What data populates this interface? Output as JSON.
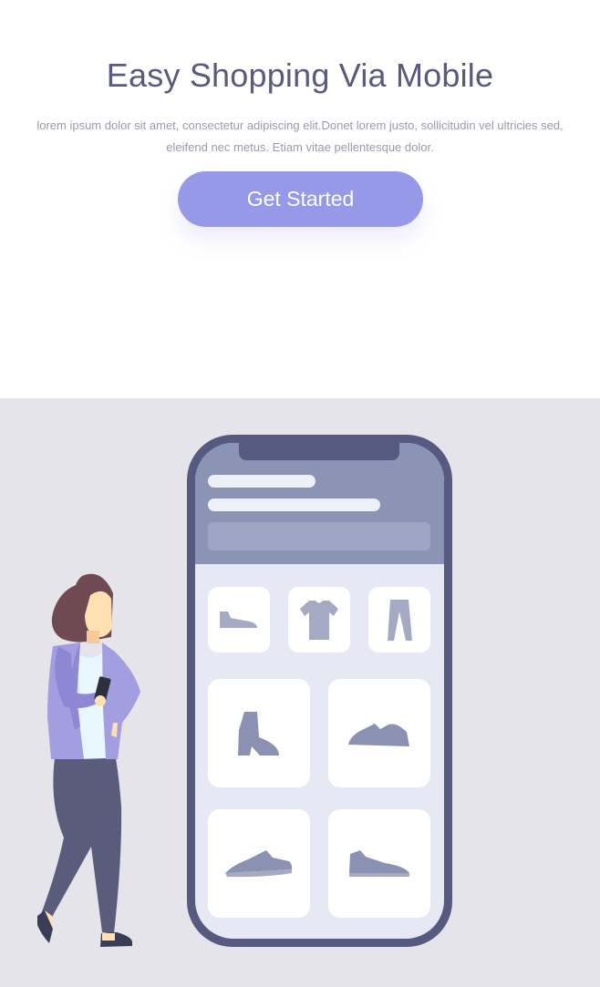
{
  "hero": {
    "title": "Easy Shopping Via Mobile",
    "description": "lorem ipsum dolor sit amet, consectetur adipiscing elit.Donet lorem justo, sollicitudin vel ultricies sed, eleifend nec metus. Etiam vitae pellentesque dolor.",
    "cta_label": "Get Started"
  },
  "colors": {
    "accent": "#9599e8",
    "title": "#5a5a7c",
    "illustration_bg": "#e4e4ea",
    "phone_frame": "#575a80"
  },
  "illustration": {
    "products": [
      "shoe-icon",
      "tshirt-icon",
      "pants-icon",
      "boot-icon",
      "sneaker-icon",
      "sneaker-icon",
      "sneaker-icon"
    ]
  }
}
